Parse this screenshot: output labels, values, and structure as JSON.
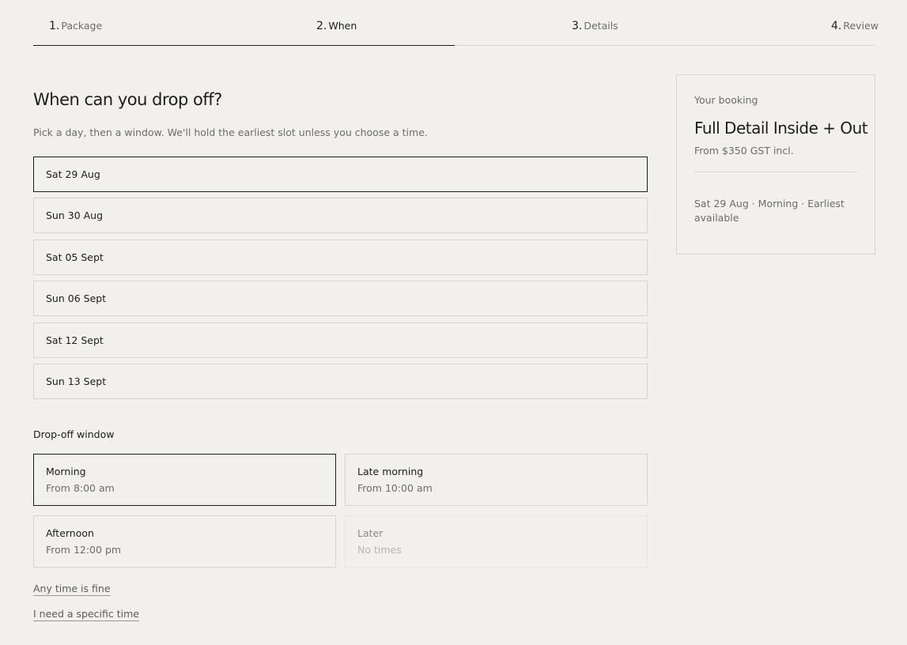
{
  "steps": [
    {
      "num": "1.",
      "label": "Package"
    },
    {
      "num": "2.",
      "label": "When"
    },
    {
      "num": "3.",
      "label": "Details"
    },
    {
      "num": "4.",
      "label": "Review"
    }
  ],
  "progress_fraction": 0.5,
  "heading": "When can you drop off?",
  "subheading": "Pick a day, then a window. We'll hold the earliest slot unless you choose a time.",
  "dates": [
    {
      "label": "Sat 29 Aug",
      "selected": true
    },
    {
      "label": "Sun 30 Aug",
      "selected": false
    },
    {
      "label": "Sat 05 Sept",
      "selected": false
    },
    {
      "label": "Sun 06 Sept",
      "selected": false
    },
    {
      "label": "Sat 12 Sept",
      "selected": false
    },
    {
      "label": "Sun 13 Sept",
      "selected": false
    }
  ],
  "window_section_label": "Drop-off window",
  "windows": [
    {
      "name": "Morning",
      "time": "From 8:00 am",
      "selected": true,
      "disabled": false
    },
    {
      "name": "Late morning",
      "time": "From 10:00 am",
      "selected": false,
      "disabled": false
    },
    {
      "name": "Afternoon",
      "time": "From 12:00 pm",
      "selected": false,
      "disabled": false
    },
    {
      "name": "Later",
      "time": "No times",
      "selected": false,
      "disabled": true
    }
  ],
  "links": {
    "any_time": "Any time is fine",
    "specific_time": "I need a specific time"
  },
  "summary": {
    "label": "Your booking",
    "package": "Full Detail Inside + Out",
    "price": "From $350 GST incl.",
    "slot": "Sat 29 Aug · Morning · Earliest available"
  }
}
